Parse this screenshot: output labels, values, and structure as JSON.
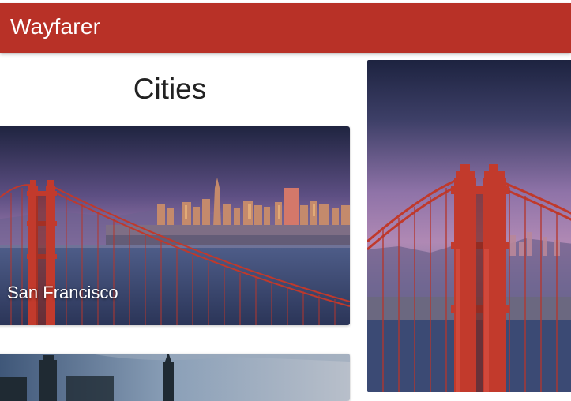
{
  "app": {
    "brand": "Wayfarer"
  },
  "page": {
    "title": "Cities"
  },
  "cities": [
    {
      "name": "San Francisco"
    },
    {
      "name": ""
    }
  ],
  "colors": {
    "navbar": "#b83127",
    "bridge": "#c0392b",
    "sky_top": "#232a45",
    "sky_mid": "#8e6fa3",
    "water": "#3b4a74"
  }
}
